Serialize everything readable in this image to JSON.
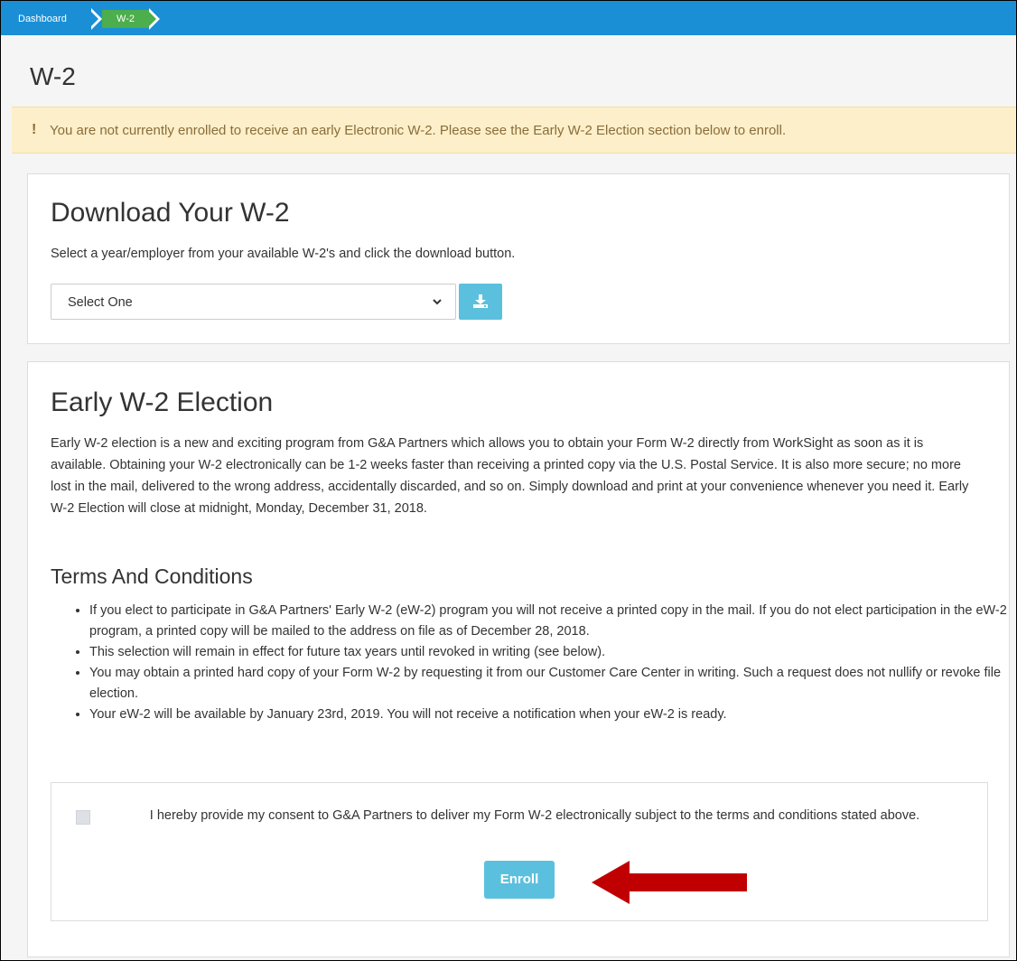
{
  "breadcrumb": {
    "home": "Dashboard",
    "current": "W-2"
  },
  "page": {
    "title": "W-2"
  },
  "alert": {
    "icon": "exclamation-icon",
    "text": "You are not currently enrolled to receive an early Electronic W-2. Please see the Early W-2 Election section below to enroll."
  },
  "download": {
    "title": "Download Your W-2",
    "description": "Select a year/employer from your available W-2's and click the download button.",
    "select_value": "Select One",
    "button_icon": "download-icon"
  },
  "early": {
    "title": "Early W-2 Election",
    "paragraph": "Early W-2 election is a new and exciting program from G&A Partners which allows you to obtain your Form W-2 directly from WorkSight as soon as it is available. Obtaining your W-2 electronically can be 1-2 weeks faster than receiving a printed copy via the U.S. Postal Service. It is also more secure; no more lost in the mail, delivered to the wrong address, accidentally discarded, and so on. Simply download and print at your convenience whenever you need it. Early W-2 Election will close at midnight, Monday, December 31, 2018.",
    "terms_title": "Terms And Conditions",
    "terms": [
      "If you elect to participate in G&A Partners' Early W-2 (eW-2) program you will not receive a printed copy in the mail. If you do not elect participation in the eW-2 program, a printed copy will be mailed to the address on file as of December 28, 2018.",
      "This selection will remain in effect for future tax years until revoked in writing (see below).",
      "You may obtain a printed hard copy of your Form W-2 by requesting it from our Customer Care Center in writing. Such a request does not nullify or revoke file election.",
      "Your eW-2 will be available by January 23rd, 2019. You will not receive a notification when your eW-2 is ready."
    ],
    "consent_text": "I hereby provide my consent to G&A Partners to deliver my Form W-2 electronically subject to the terms and conditions stated above.",
    "consent_checked": false,
    "enroll_label": "Enroll"
  },
  "colors": {
    "topbar": "#1a8fd6",
    "breadcrumb_current": "#4cae4c",
    "alert_bg": "#fcefc9",
    "button": "#5bc0de",
    "annotation_arrow": "#c00000"
  }
}
